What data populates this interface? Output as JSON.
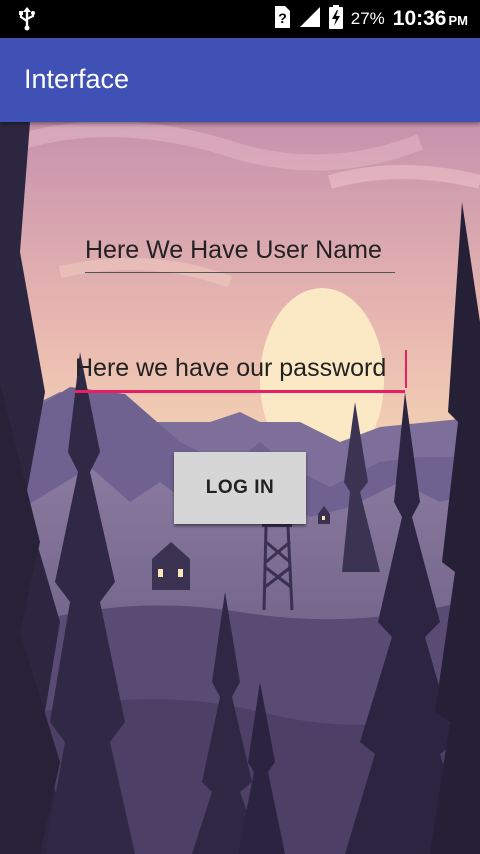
{
  "status_bar": {
    "battery_percent": "27%",
    "time": "10:36",
    "ampm": "PM",
    "icons": [
      "usb-icon",
      "sim-unknown-icon",
      "signal-icon",
      "battery-charging-icon"
    ]
  },
  "app_bar": {
    "title": "Interface",
    "color": "#3f51b5"
  },
  "form": {
    "username_value": "Here We Have User Name",
    "password_value": "Here we have our password",
    "login_label": "LOG IN",
    "accent_color": "#e91e63"
  }
}
